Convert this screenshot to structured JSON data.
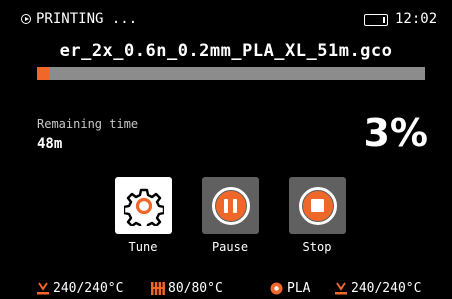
{
  "header": {
    "status": "PRINTING ...",
    "time": "12:02"
  },
  "job": {
    "filename": "er_2x_0.6n_0.2mm_PLA_XL_51m.gco",
    "progress_fraction": 0.03,
    "remaining_label": "Remaining time",
    "remaining_value": "48m",
    "percent": "3%"
  },
  "actions": {
    "tune": "Tune",
    "pause": "Pause",
    "stop": "Stop"
  },
  "footer": {
    "nozzle_temp": "240/240°C",
    "bed_temp": "80/80°C",
    "filament": "PLA",
    "nozzle2_temp": "240/240°C"
  },
  "colors": {
    "accent": "#f0672a",
    "track": "#8c8c8c",
    "button_gray": "#606060",
    "background": "#000000"
  },
  "icons": [
    "play-circle-icon",
    "storage-icon",
    "gear-icon",
    "pause-icon",
    "stop-icon",
    "nozzle-icon",
    "heatbed-icon",
    "filament-spool-icon"
  ]
}
